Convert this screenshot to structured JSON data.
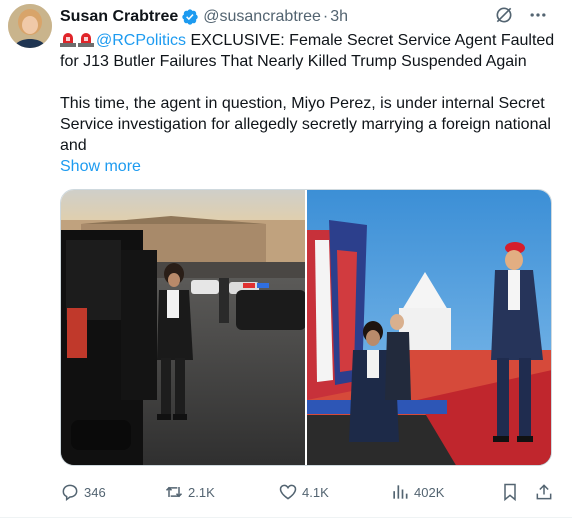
{
  "author": {
    "name": "Susan Crabtree",
    "handle": "@susancrabtree",
    "separator": "·",
    "time": "3h",
    "verified": true
  },
  "tweet": {
    "emoji": [
      "rotating-light-emoji",
      "rotating-light-emoji"
    ],
    "mention": "@RCPolitics",
    "headline": " EXCLUSIVE: Female Secret Service Agent Faulted for J13 Butler Failures That Nearly Killed Trump Suspended Again",
    "body": "This time, the agent in question, Miyo Perez, is under internal Secret Service investigation for allegedly secretly marrying a foreign national and",
    "show_more": "Show more"
  },
  "media": {
    "photos": [
      "photo-agent-at-suv",
      "photo-trump-at-rally"
    ]
  },
  "stats": {
    "replies": "346",
    "reposts": "2.1K",
    "likes": "4.1K",
    "views": "402K"
  },
  "colors": {
    "accent": "#1d9bf0",
    "text": "#0f1419",
    "muted": "#536471"
  }
}
